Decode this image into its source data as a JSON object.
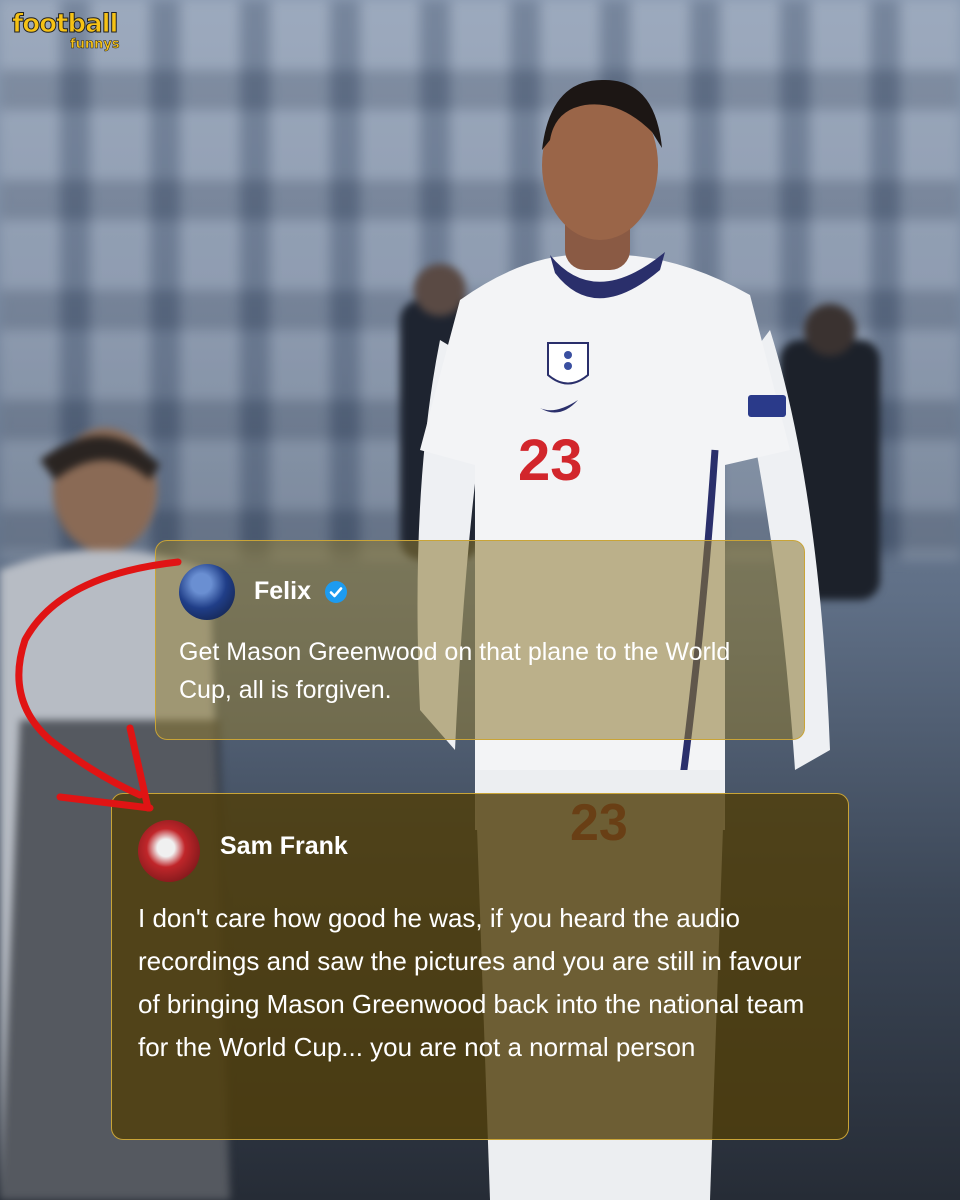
{
  "brand": {
    "logo_line1": "football",
    "logo_line2": "funnys"
  },
  "jersey_number": "23",
  "tweets": [
    {
      "author": "Felix",
      "verified": true,
      "text": "Get Mason Greenwood on that plane to the World Cup, all is forgiven."
    },
    {
      "author": "Sam Frank",
      "verified": false,
      "text": "I don't care how good he was, if you heard the audio recordings and saw the pictures and you are still in favour of bringing Mason Greenwood back into the national team for the World Cup... you are not a normal person"
    }
  ],
  "colors": {
    "arrow": "#e01414",
    "tweet_border": "#c9a437",
    "brand_yellow": "#f6c215",
    "verified_blue": "#1d9bf0"
  },
  "icons": [
    "verified-badge-icon",
    "arrow-annotation"
  ]
}
